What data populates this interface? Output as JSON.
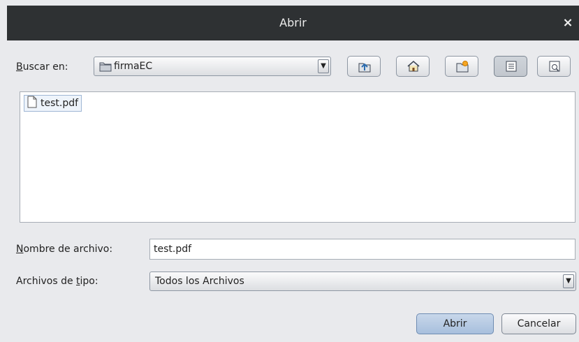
{
  "window": {
    "title": "Abrir",
    "close_glyph": "×"
  },
  "look_in": {
    "label_mnemonic": "B",
    "label_rest": "uscar en:",
    "folder": "firmaEC",
    "folder_icon": "folder-icon",
    "arrow_glyph": "▼"
  },
  "toolbar": {
    "buttons": [
      {
        "name": "up-one-level",
        "icon": "folder-up-icon"
      },
      {
        "name": "home",
        "icon": "home-icon"
      },
      {
        "name": "new-folder",
        "icon": "new-folder-icon"
      },
      {
        "name": "list-view",
        "icon": "list-icon",
        "pressed": true
      },
      {
        "name": "details-view",
        "icon": "details-icon"
      }
    ]
  },
  "files": [
    {
      "name": "test.pdf",
      "icon": "file-icon",
      "selected": true
    }
  ],
  "filename": {
    "label_mnemonic": "N",
    "label_rest": "ombre de archivo:",
    "value": "test.pdf"
  },
  "filetype": {
    "label_pre": "Archivos de ",
    "label_mnemonic": "t",
    "label_post": "ipo:",
    "value": "Todos los Archivos",
    "arrow_glyph": "▼"
  },
  "actions": {
    "open_label": "Abrir",
    "cancel_label": "Cancelar"
  }
}
